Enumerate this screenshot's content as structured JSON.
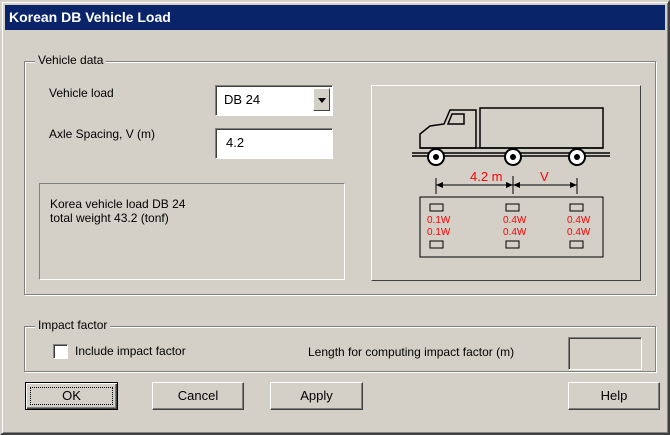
{
  "window": {
    "title": "Korean DB Vehicle Load"
  },
  "vehicle_group": {
    "label": "Vehicle data",
    "vehicle_load_label": "Vehicle load",
    "vehicle_load_value": "DB 24",
    "axle_spacing_label": "Axle Spacing, V (m)",
    "axle_spacing_value": "4.2",
    "info_line1": "Korea vehicle load DB 24",
    "info_line2": "total weight 43.2 (tonf)"
  },
  "diagram": {
    "dim1": "4.2 m",
    "dim2": "V",
    "front_axle_top": "0.1W",
    "front_axle_bottom": "0.1W",
    "middle_axle_top": "0.4W",
    "middle_axle_bottom": "0.4W",
    "rear_axle_top": "0.4W",
    "rear_axle_bottom": "0.4W",
    "accent_color": "#ff0000"
  },
  "impact_group": {
    "label": "Impact factor",
    "include_label": "Include impact factor",
    "include_checked": false,
    "length_label": "Length for computing impact factor (m)",
    "length_value": ""
  },
  "buttons": {
    "ok": "OK",
    "cancel": "Cancel",
    "apply": "Apply",
    "help": "Help"
  }
}
